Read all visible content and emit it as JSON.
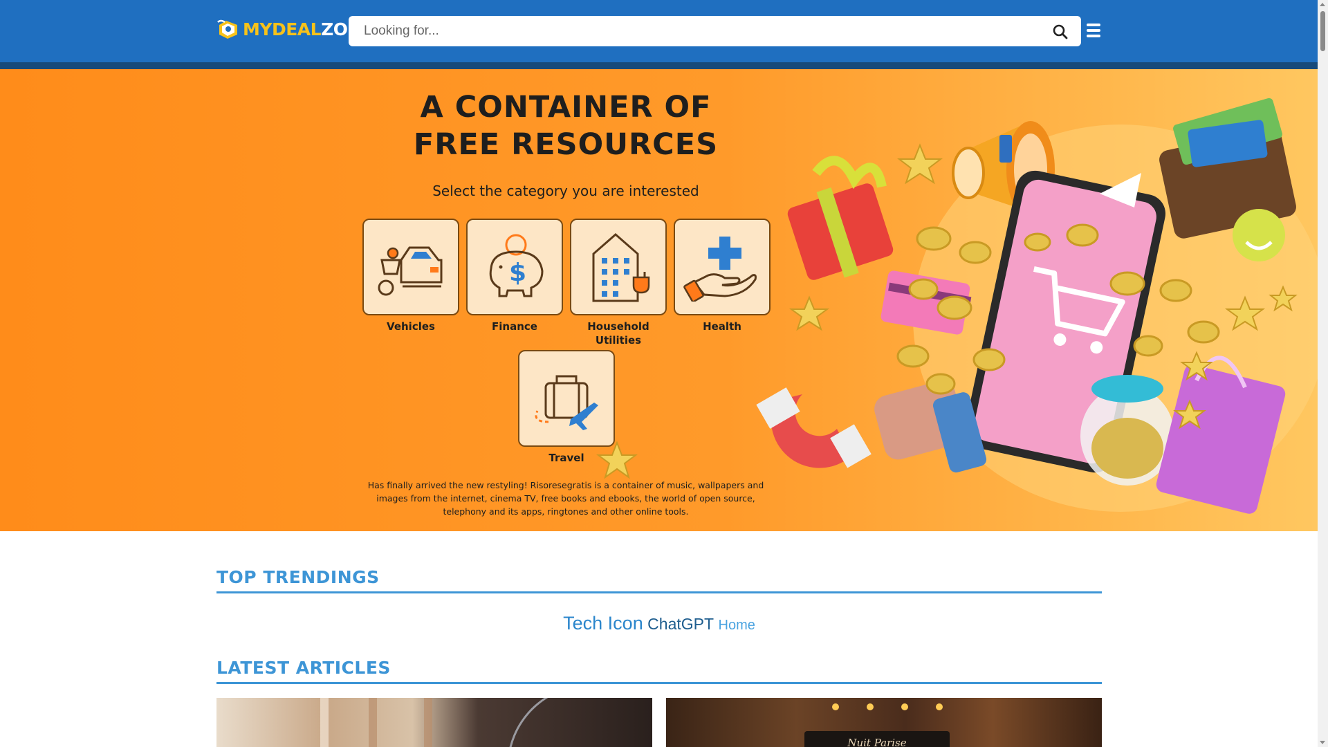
{
  "header": {
    "logo_text_yellow": "MYDEAL",
    "logo_text_white": "ZON",
    "search_placeholder": "Looking for...",
    "colors": {
      "bar": "#1f6fc0",
      "stripe": "#174a7a",
      "logo_accent": "#f7c21a"
    }
  },
  "hero": {
    "title_line1": "A CONTAINER OF",
    "title_line2": "FREE RESOURCES",
    "subtitle": "Select the category you are interested",
    "categories": [
      {
        "label": "Vehicles",
        "icon": "vehicles-icon"
      },
      {
        "label": "Finance",
        "icon": "piggy-bank-icon"
      },
      {
        "label": "Household Utilities",
        "icon": "building-plug-icon"
      },
      {
        "label": "Health",
        "icon": "hand-cross-icon"
      },
      {
        "label": "Travel",
        "icon": "suitcase-plane-icon"
      }
    ],
    "description": "Has finally arrived the new restyling! Risoresegratis is a container of music, wallpapers and images from the internet, cinema TV, free books and ebooks, the world of open source, telephony and its apps, ringtones and other online tools.",
    "colors": {
      "background": "#ff8c1a",
      "tile": "#fde6c6",
      "icon_blue": "#2f7fd0"
    }
  },
  "top_trendings": {
    "title": "TOP TRENDINGS",
    "tags": [
      "Tech Icon",
      "ChatGPT",
      "Home"
    ]
  },
  "latest_articles": {
    "title": "LATEST ARTICLES",
    "articles": [
      {
        "image": "car-showroom-image"
      },
      {
        "image": "storefront-image",
        "sign_text": "Nuit Parise"
      }
    ]
  },
  "section_color": "#3d95d6"
}
